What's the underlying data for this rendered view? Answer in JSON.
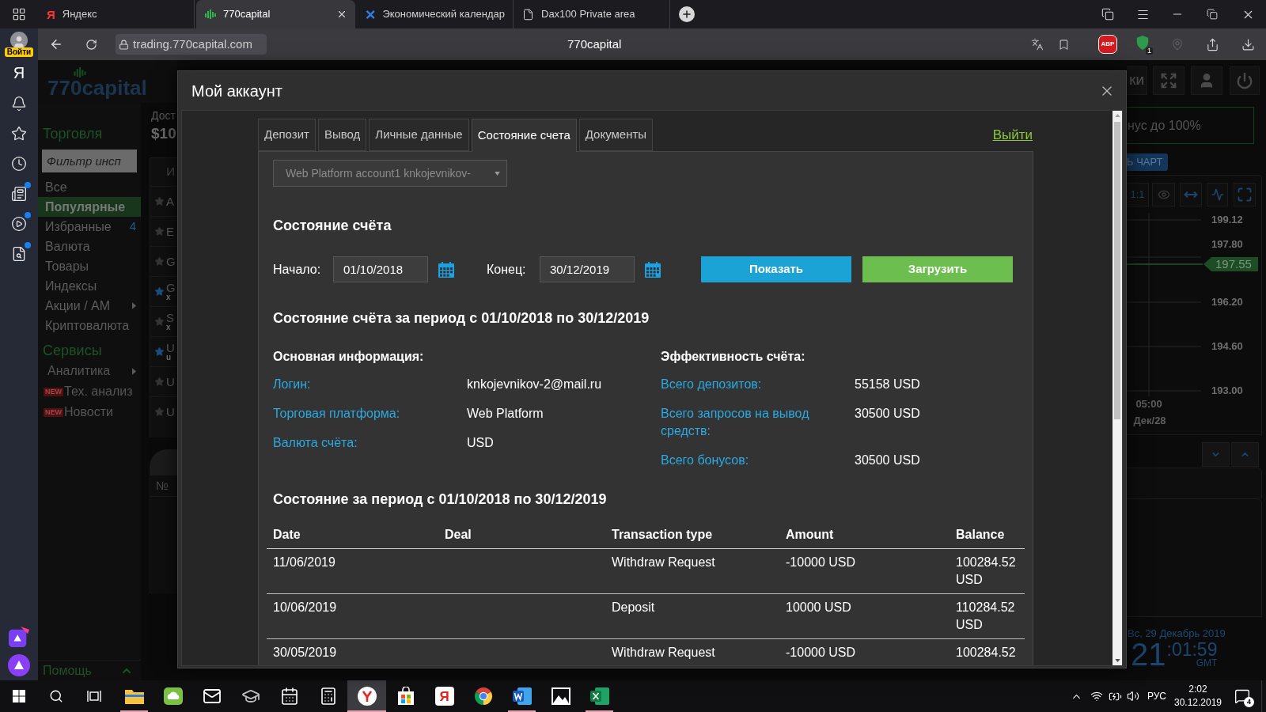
{
  "browser": {
    "tabs": [
      {
        "title": "Яндекс",
        "logo_letter": "Я",
        "selected": false
      },
      {
        "title": "770capital",
        "selected": true
      },
      {
        "title": "Экономический календар",
        "selected": false
      },
      {
        "title": "Dax100 Private area",
        "selected": false
      }
    ],
    "address": "trading.770capital.com",
    "page_title": "770capital",
    "adblock": "ABP",
    "shield_count": "1"
  },
  "yandex_sidebar": {
    "login": "Войти",
    "home_letter": "Я",
    "items": [
      {
        "dot": false
      },
      {
        "dot": false
      },
      {
        "dot": false
      },
      {
        "dot": true
      },
      {
        "dot": true
      },
      {
        "dot": true
      }
    ]
  },
  "app": {
    "logo": "770capital",
    "menu": {
      "trading_title": "Торговля",
      "filter_placeholder": "Фильтр инсп",
      "items": [
        {
          "label": "Все",
          "selected": false,
          "submenu": false
        },
        {
          "label": "Популярные",
          "selected": true,
          "submenu": false
        },
        {
          "label": "Избранные",
          "selected": false,
          "submenu": false,
          "count": "4"
        },
        {
          "label": "Валюта",
          "selected": false,
          "submenu": false
        },
        {
          "label": "Товары",
          "selected": false,
          "submenu": false
        },
        {
          "label": "Индексы",
          "selected": false,
          "submenu": false
        },
        {
          "label": "Акции / АМ",
          "selected": false,
          "submenu": true
        },
        {
          "label": "Криптовалюта",
          "selected": false,
          "submenu": false
        }
      ],
      "services_title": "Сервисы",
      "services": [
        {
          "label": "Аналитика",
          "submenu": true
        },
        {
          "label": "Тех. анализ",
          "submenu": false,
          "badge": "NEW"
        },
        {
          "label": "Новости",
          "submenu": false,
          "badge": "NEW"
        }
      ],
      "help": "Помощь"
    },
    "account": {
      "label": "Дост",
      "value": "$10"
    },
    "instruments": {
      "header": "И",
      "rows": [
        {
          "symbol": "A",
          "favorite": false
        },
        {
          "symbol": "E",
          "favorite": false
        },
        {
          "symbol": "G",
          "favorite": false
        },
        {
          "symbol": "G",
          "sub": "x",
          "favorite": true
        },
        {
          "symbol": "S",
          "sub": "x",
          "favorite": false
        },
        {
          "symbol": "U",
          "sub": "u",
          "favorite": true
        },
        {
          "symbol": "U",
          "favorite": false
        },
        {
          "symbol": "U",
          "favorite": false
        }
      ]
    },
    "orders_header": "№",
    "header_button": "КИ",
    "promo": "нус до 100%",
    "chart_button": "Ь ЧАРТ",
    "chart": {
      "zoom_label": "1:1",
      "price_labels": [
        "199.12",
        "197.80",
        "196.20",
        "194.60",
        "193.00"
      ],
      "current_price": "197.55",
      "time_label": "05:00",
      "date_label": "Дек/28"
    },
    "clock": {
      "date": "Вс, 29 Декабрь 2019",
      "hours": "21",
      "minutes_seconds": ":01:59",
      "timezone": "GMT"
    }
  },
  "modal": {
    "title": "Мой аккаунт",
    "tabs": [
      {
        "label": "Депозит",
        "selected": false
      },
      {
        "label": "Вывод",
        "selected": false
      },
      {
        "label": "Личные данные",
        "selected": false
      },
      {
        "label": "Состояние счета",
        "selected": true
      },
      {
        "label": "Документы",
        "selected": false
      }
    ],
    "logout": "Выйти",
    "account_select": "Web Platform account1 knkojevnikov-",
    "statement_title": "Состояние счёта",
    "period": {
      "start_label": "Начало:",
      "start_value": "01/10/2018",
      "end_label": "Конец:",
      "end_value": "30/12/2019",
      "show_button": "Показать",
      "download_button": "Загрузить"
    },
    "period_heading": "Состояние счёта за период с 01/10/2018 по 30/12/2019",
    "basic_info": {
      "title": "Основная информация:",
      "rows": [
        {
          "label": "Логин:",
          "value": "knkojevnikov-2@mail.ru"
        },
        {
          "label": "Торговая платформа:",
          "value": "Web Platform"
        },
        {
          "label": "Валюта счёта:",
          "value": "USD"
        }
      ]
    },
    "performance": {
      "title": "Эффективность счёта:",
      "rows": [
        {
          "label": "Всего депозитов:",
          "value": "55158 USD"
        },
        {
          "label": "Всего запросов на вывод средств:",
          "value": "30500 USD"
        },
        {
          "label": "Всего бонусов:",
          "value": "30500 USD"
        }
      ]
    },
    "transactions_heading": "Состояние за период с 01/10/2018 по 30/12/2019",
    "table": {
      "columns": [
        "Date",
        "Deal",
        "Transaction type",
        "Amount",
        "Balance"
      ],
      "rows": [
        {
          "date": "11/06/2019",
          "transaction_type": "Withdraw Request",
          "amount": "-10000 USD",
          "balance": "100284.52 USD"
        },
        {
          "date": "10/06/2019",
          "transaction_type": "Deposit",
          "amount": "10000 USD",
          "balance": "110284.52 USD"
        },
        {
          "date": "30/05/2019",
          "transaction_type": "Withdraw Request",
          "amount": "-10000 USD",
          "balance": "100284.52"
        }
      ]
    }
  },
  "taskbar": {
    "apps": [
      {
        "running": true,
        "selected": false
      },
      {
        "running": false,
        "selected": false
      },
      {
        "running": false,
        "selected": false
      },
      {
        "running": false,
        "selected": false
      },
      {
        "running": false,
        "selected": false
      },
      {
        "running": false,
        "selected": false
      },
      {
        "running": true,
        "selected": true
      },
      {
        "running": false,
        "selected": false
      },
      {
        "running": false,
        "selected": false,
        "letter": "Я"
      },
      {
        "running": false,
        "selected": false
      },
      {
        "running": true,
        "selected": false
      },
      {
        "running": false,
        "selected": false
      },
      {
        "running": true,
        "selected": false
      }
    ],
    "tray": {
      "language": "РУС",
      "time": "2:02",
      "date": "30.12.2019",
      "notifications": "4"
    }
  }
}
